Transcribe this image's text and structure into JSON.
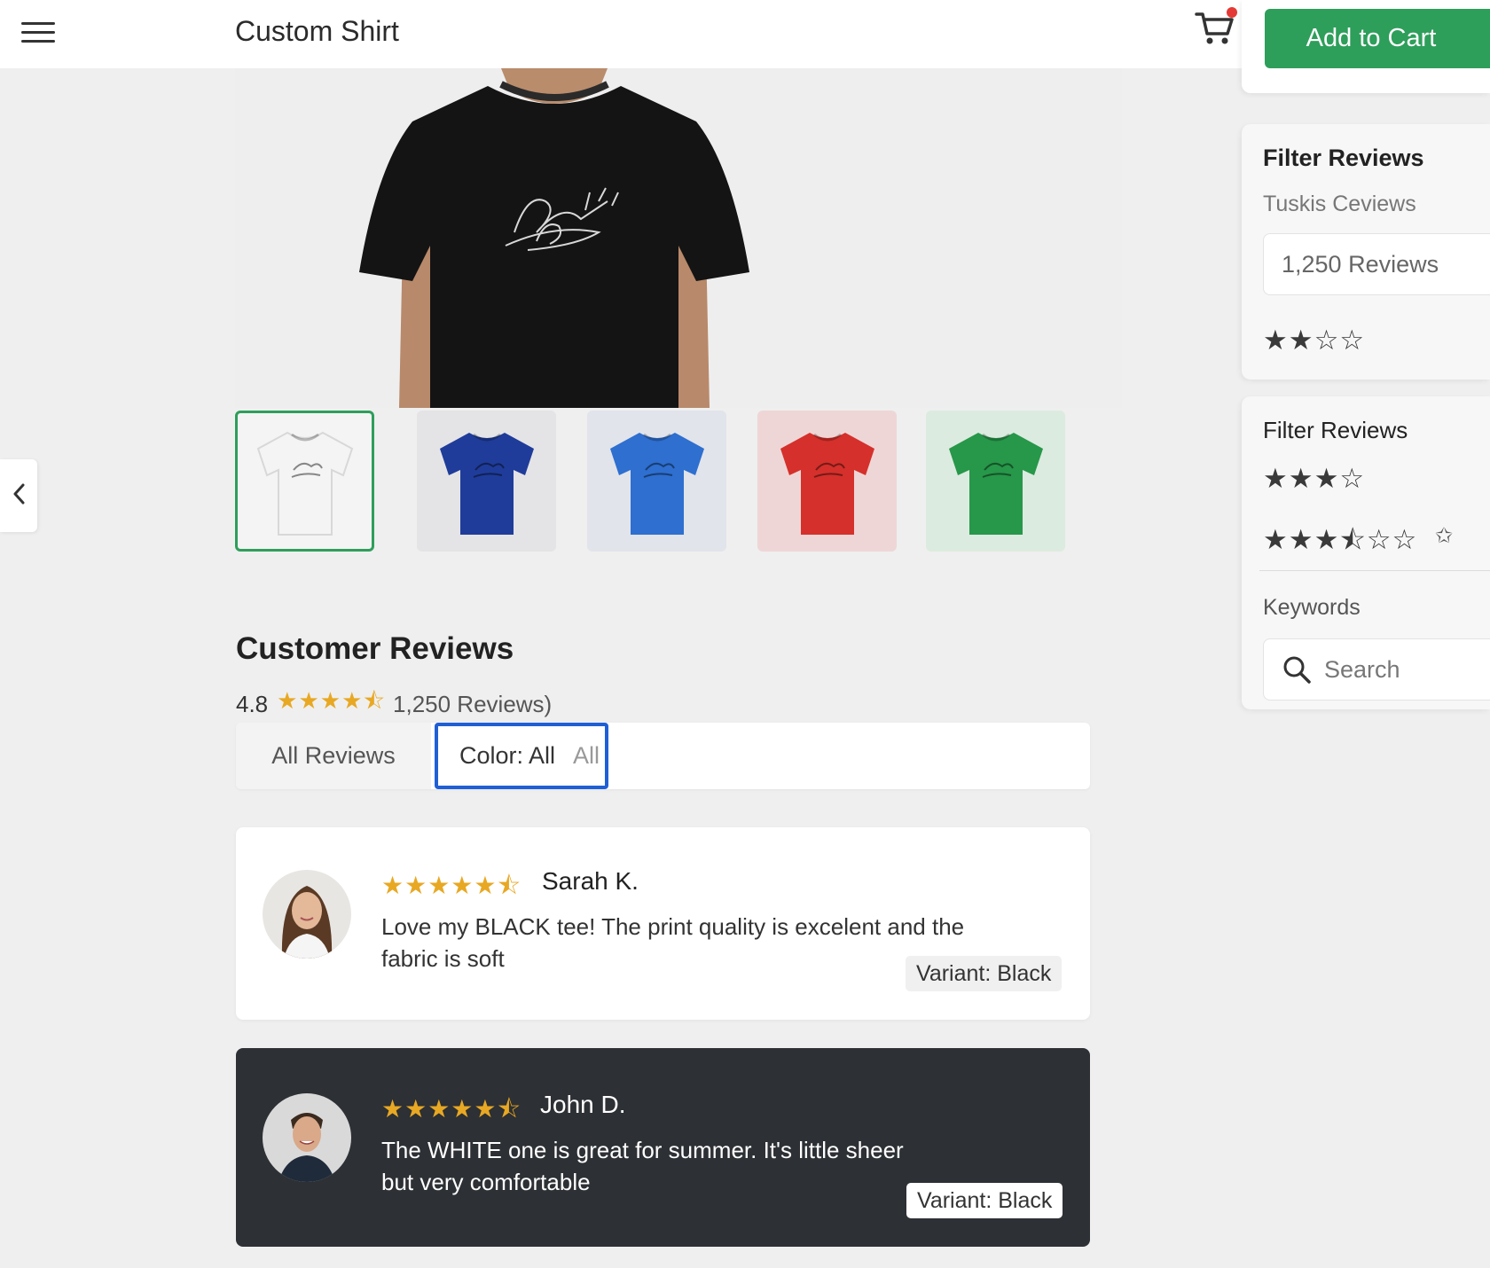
{
  "header": {
    "title": "Custom Shirt",
    "cart_icon": "shopping-cart-icon",
    "add_to_cart_label": "Add to Cart",
    "accent_color": "#2e9e5b"
  },
  "filter_panel_1": {
    "heading": "Filter Reviews",
    "subheading": "Tuskis Ceviews",
    "reviews_count_value": "1,250 Reviews",
    "stars": "★★☆☆"
  },
  "filter_panel_2": {
    "heading": "Filter Reviews",
    "stars_row_1": "★★★☆",
    "stars_row_2": "★★★⯪☆☆",
    "extra_symbol": "✩",
    "keywords_label": "Keywords",
    "search_placeholder": "Search",
    "search_icon": "search-icon"
  },
  "gallery": {
    "main_image": "black-tshirt-photo",
    "thumbnails": [
      {
        "name": "white",
        "color": "#f4f4f4",
        "bg": "#f4f4f4"
      },
      {
        "name": "navy",
        "color": "#1f3c9a",
        "bg": "#e4e4e6"
      },
      {
        "name": "blue",
        "color": "#2e6fd0",
        "bg": "#e1e4ea"
      },
      {
        "name": "red",
        "color": "#d5302b",
        "bg": "#efd6d6"
      },
      {
        "name": "green",
        "color": "#27974a",
        "bg": "#dcebdf"
      }
    ]
  },
  "reviews": {
    "title": "Customer Reviews",
    "average": "4.8",
    "average_stars": "★★★★⯪",
    "count_text": "1,250 Reviews)",
    "tab_all_label": "All Reviews",
    "color_filter_label": "Color: All",
    "color_filter_trailing": "All",
    "items": [
      {
        "stars": "★★★★★⯪",
        "author": "Sarah K.",
        "text": "Love my BLACK tee! The print quality is excelent and the fabric is soft",
        "variant": "Variant: Black"
      },
      {
        "stars": "★★★★★⯪",
        "author": "John D.",
        "text": "The WHITE one is great for summer. It's little sheer but very comfortable",
        "variant": "Variant: Black"
      }
    ]
  }
}
